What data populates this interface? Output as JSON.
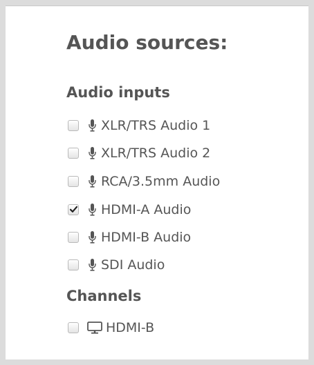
{
  "page": {
    "title": "Audio sources:"
  },
  "sections": {
    "audio_inputs": {
      "heading": "Audio inputs",
      "items": [
        {
          "label": "XLR/TRS Audio 1",
          "icon": "microphone-icon",
          "checked": false
        },
        {
          "label": "XLR/TRS Audio 2",
          "icon": "microphone-icon",
          "checked": false
        },
        {
          "label": "RCA/3.5mm Audio",
          "icon": "microphone-icon",
          "checked": false
        },
        {
          "label": "HDMI-A Audio",
          "icon": "microphone-icon",
          "checked": true
        },
        {
          "label": "HDMI-B Audio",
          "icon": "microphone-icon",
          "checked": false
        },
        {
          "label": "SDI Audio",
          "icon": "microphone-icon",
          "checked": false
        }
      ]
    },
    "channels": {
      "heading": "Channels",
      "items": [
        {
          "label": "HDMI-B",
          "icon": "monitor-icon",
          "checked": false
        }
      ]
    }
  },
  "colors": {
    "text": "#555555",
    "background": "#dcdcdc",
    "panel": "#ffffff"
  }
}
